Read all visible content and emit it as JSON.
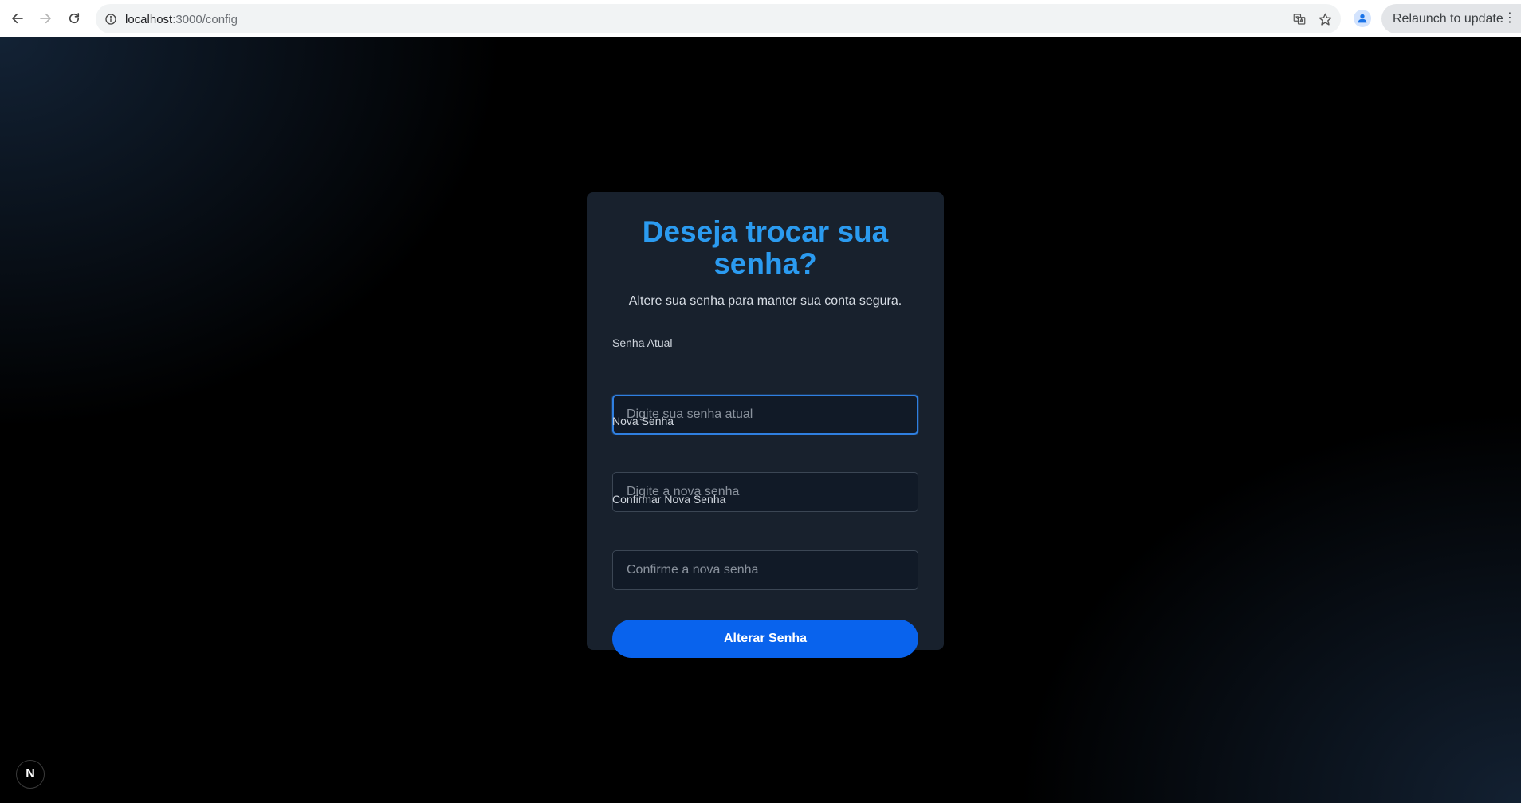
{
  "browser": {
    "url_host": "localhost",
    "url_path": ":3000/config",
    "relaunch_label": "Relaunch to update",
    "icons": {
      "back": "arrow-left-icon",
      "forward": "arrow-right-icon",
      "reload": "reload-icon",
      "site_info": "info-icon",
      "translate": "translate-icon",
      "bookmark": "star-icon",
      "profile": "profile-icon",
      "menu": "more-vertical-icon"
    }
  },
  "form": {
    "title": "Deseja trocar sua senha?",
    "subtitle": "Altere sua senha para manter sua conta segura.",
    "fields": [
      {
        "label": "Senha Atual",
        "placeholder": "Digite sua senha atual",
        "value": "",
        "focused": true
      },
      {
        "label": "Nova Senha",
        "placeholder": "Digite a nova senha",
        "value": ""
      },
      {
        "label": "Confirmar Nova Senha",
        "placeholder": "Confirme a nova senha",
        "value": ""
      }
    ],
    "submit_label": "Alterar Senha"
  },
  "dev_badge": {
    "letter": "N"
  },
  "colors": {
    "title": "#2b9bf0",
    "card_bg": "#18212d",
    "button": "#0963ed",
    "focus_border": "#2f7fe0"
  }
}
